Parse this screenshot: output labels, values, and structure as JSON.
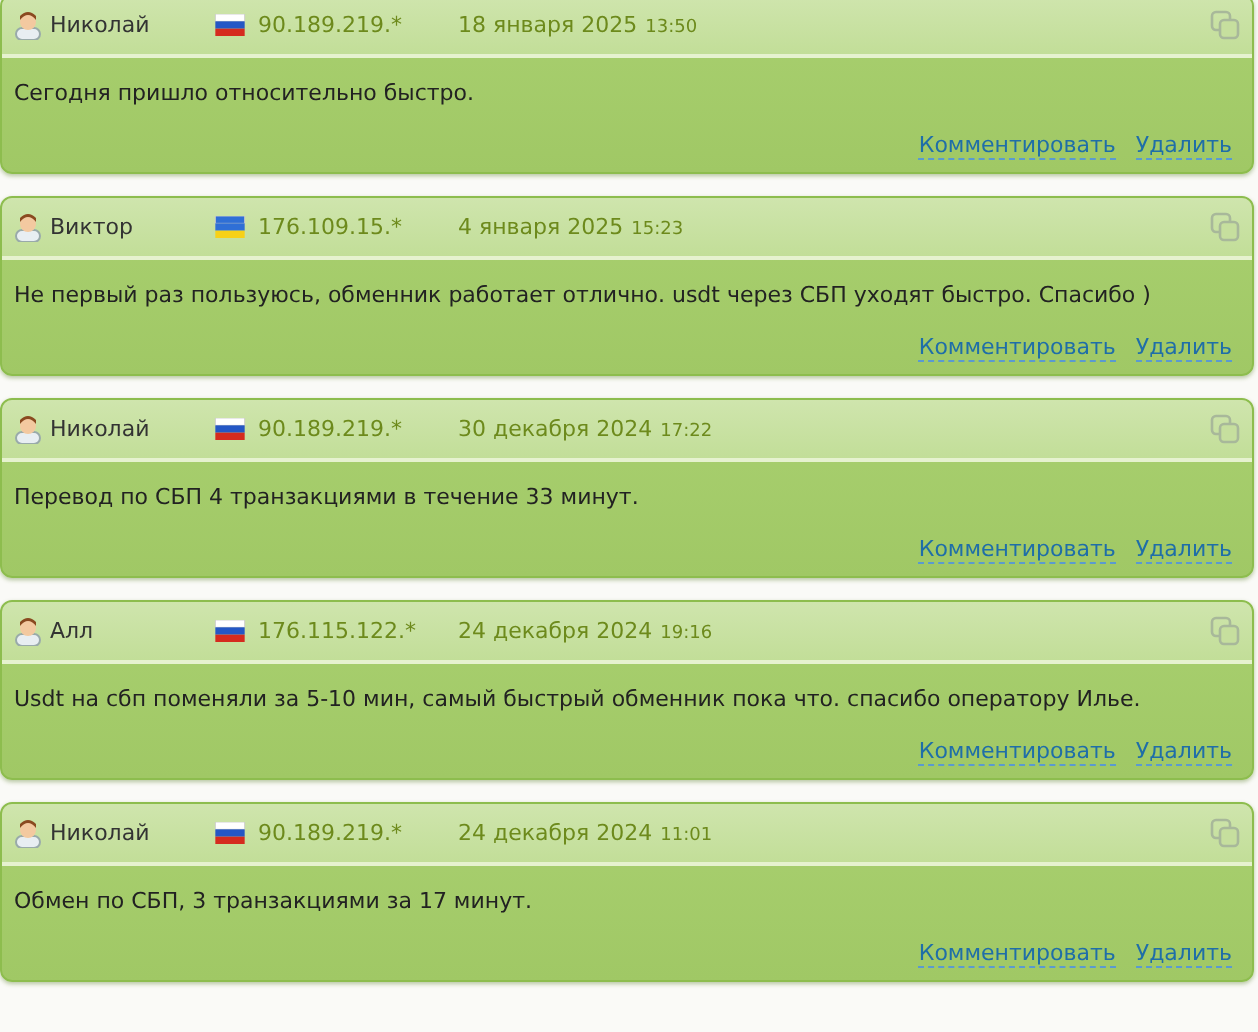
{
  "reviews": [
    {
      "author": "Николай",
      "kind": "ru",
      "ip": "90.189.219.*",
      "date": "18 января 2025",
      "time": "13:50",
      "text": "Сегодня пришло относительно быстро.",
      "actions": [
        "Комментировать",
        "Удалить"
      ]
    },
    {
      "author": "Виктор",
      "kind": "ua",
      "ip": "176.109.15.*",
      "date": "4 января 2025",
      "time": "15:23",
      "text": "Не первый раз пользуюсь, обменник работает отлично. usdt через СБП уходят быстро. Спасибо )",
      "actions": [
        "Комментировать",
        "Удалить"
      ]
    },
    {
      "author": "Николай",
      "kind": "ru",
      "ip": "90.189.219.*",
      "date": "30 декабря 2024",
      "time": "17:22",
      "text": "Перевод по СБП 4 транзакциями в течение 33 минут.",
      "actions": [
        "Комментировать",
        "Удалить"
      ]
    },
    {
      "author": "Алл",
      "kind": "ru",
      "ip": "176.115.122.*",
      "date": "24 декабря 2024",
      "time": "19:16",
      "text": "Usdt на сбп поменяли за 5-10 мин, самый быстрый обменник пока что. спасибо оператору Илье.",
      "actions": [
        "Комментировать",
        "Удалить"
      ]
    },
    {
      "author": "Николай",
      "kind": "ru",
      "ip": "90.189.219.*",
      "date": "24 декабря 2024",
      "time": "11:01",
      "text": "Обмен по СБП, 3 транзакциями за 17 минут.",
      "actions": [
        "Комментировать",
        "Удалить"
      ]
    }
  ]
}
